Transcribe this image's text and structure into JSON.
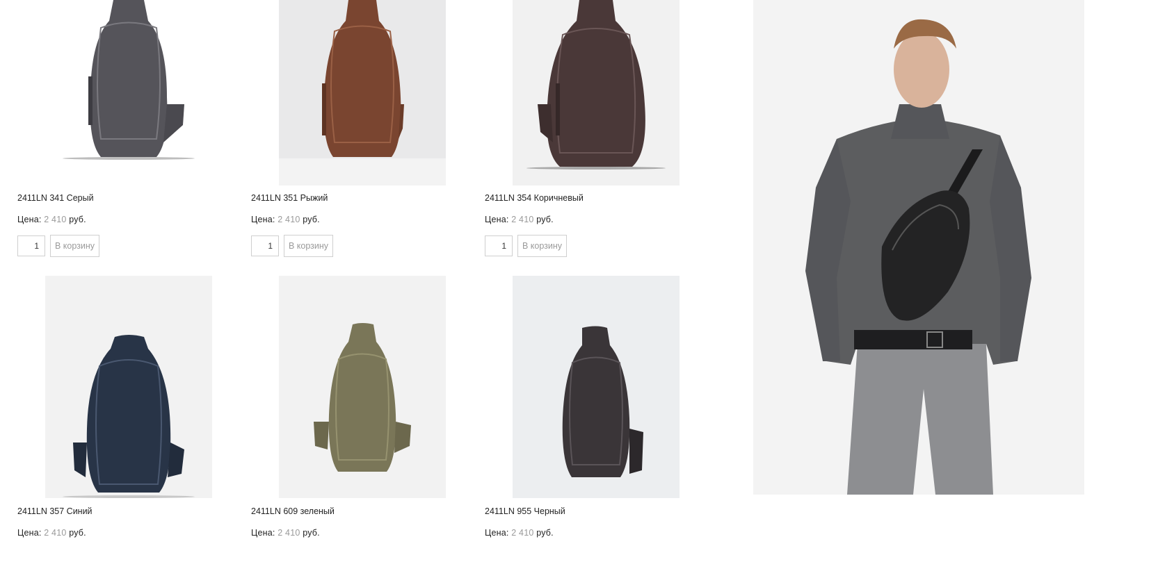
{
  "products": [
    {
      "name": "2411LN 341 Серый",
      "price_label": "Цена:",
      "price": "2 410",
      "currency": "руб.",
      "qty": "1",
      "cart_label": "В корзину",
      "color": "#55545a",
      "bg": "#ffffff",
      "icon": "bag-image"
    },
    {
      "name": "2411LN 351 Рыжий",
      "price_label": "Цена:",
      "price": "2 410",
      "currency": "руб.",
      "qty": "1",
      "cart_label": "В корзину",
      "color": "#7a4530",
      "bg": "#e9e9ea",
      "icon": "bag-image"
    },
    {
      "name": "2411LN 354 Коричневый",
      "price_label": "Цена:",
      "price": "2 410",
      "currency": "руб.",
      "qty": "1",
      "cart_label": "В корзину",
      "color": "#4a3838",
      "bg": "#f1f1f1",
      "icon": "bag-image"
    },
    {
      "name": "2411LN 357 Синий",
      "price_label": "Цена:",
      "price": "2 410",
      "currency": "руб.",
      "color": "#283447",
      "bg": "#f2f2f2",
      "icon": "bag-image"
    },
    {
      "name": "2411LN 609 зеленый",
      "price_label": "Цена:",
      "price": "2 410",
      "currency": "руб.",
      "color": "#7a7658",
      "bg": "#f2f2f2",
      "icon": "bag-image"
    },
    {
      "name": "2411LN 955 Черный",
      "price_label": "Цена:",
      "price": "2 410",
      "currency": "руб.",
      "color": "#3a3538",
      "bg": "#eceef0",
      "icon": "bag-image"
    }
  ],
  "banner": {
    "icon": "model-wearing-bag-image",
    "bg": "#f3f3f3"
  }
}
